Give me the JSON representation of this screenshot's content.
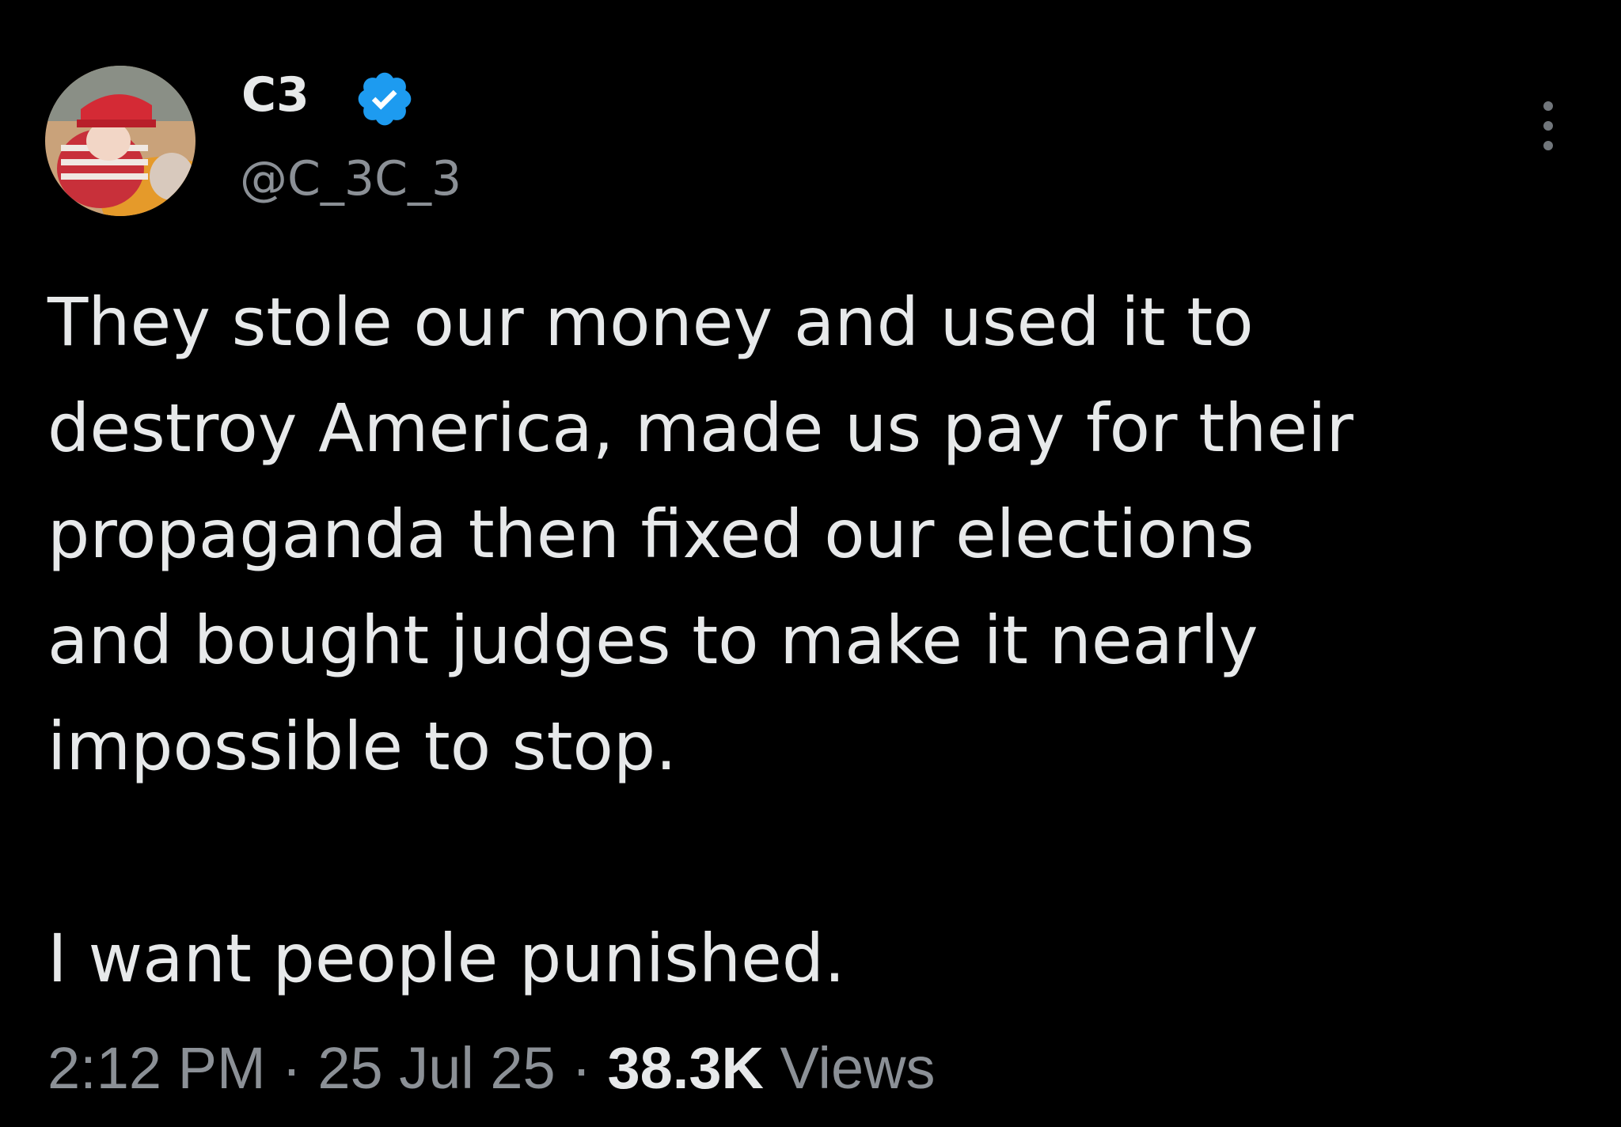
{
  "author": {
    "display_name": "C3",
    "handle": "@C_3C_3",
    "verified_icon": "verified-badge-icon",
    "avatar_icon": "avatar",
    "colors": {
      "badge": "#1d9bf0",
      "name": "#e7e9ea",
      "secondary": "#8b9096"
    }
  },
  "menu": {
    "icon": "more-options-icon"
  },
  "tweet": {
    "lines": [
      "They stole our money and used it to",
      "destroy America, made us pay for their",
      "propaganda then fixed our elections",
      "and bought judges to make it nearly",
      "impossible to stop."
    ],
    "second_paragraph": "I want people punished."
  },
  "meta": {
    "time": "2:12 PM",
    "separator": " · ",
    "date": "25 Jul 25",
    "views_count": "38.3K",
    "views_label": " Views"
  },
  "colors": {
    "background": "#000000",
    "text": "#e7e9ea",
    "accent": "#1d9bf0"
  }
}
